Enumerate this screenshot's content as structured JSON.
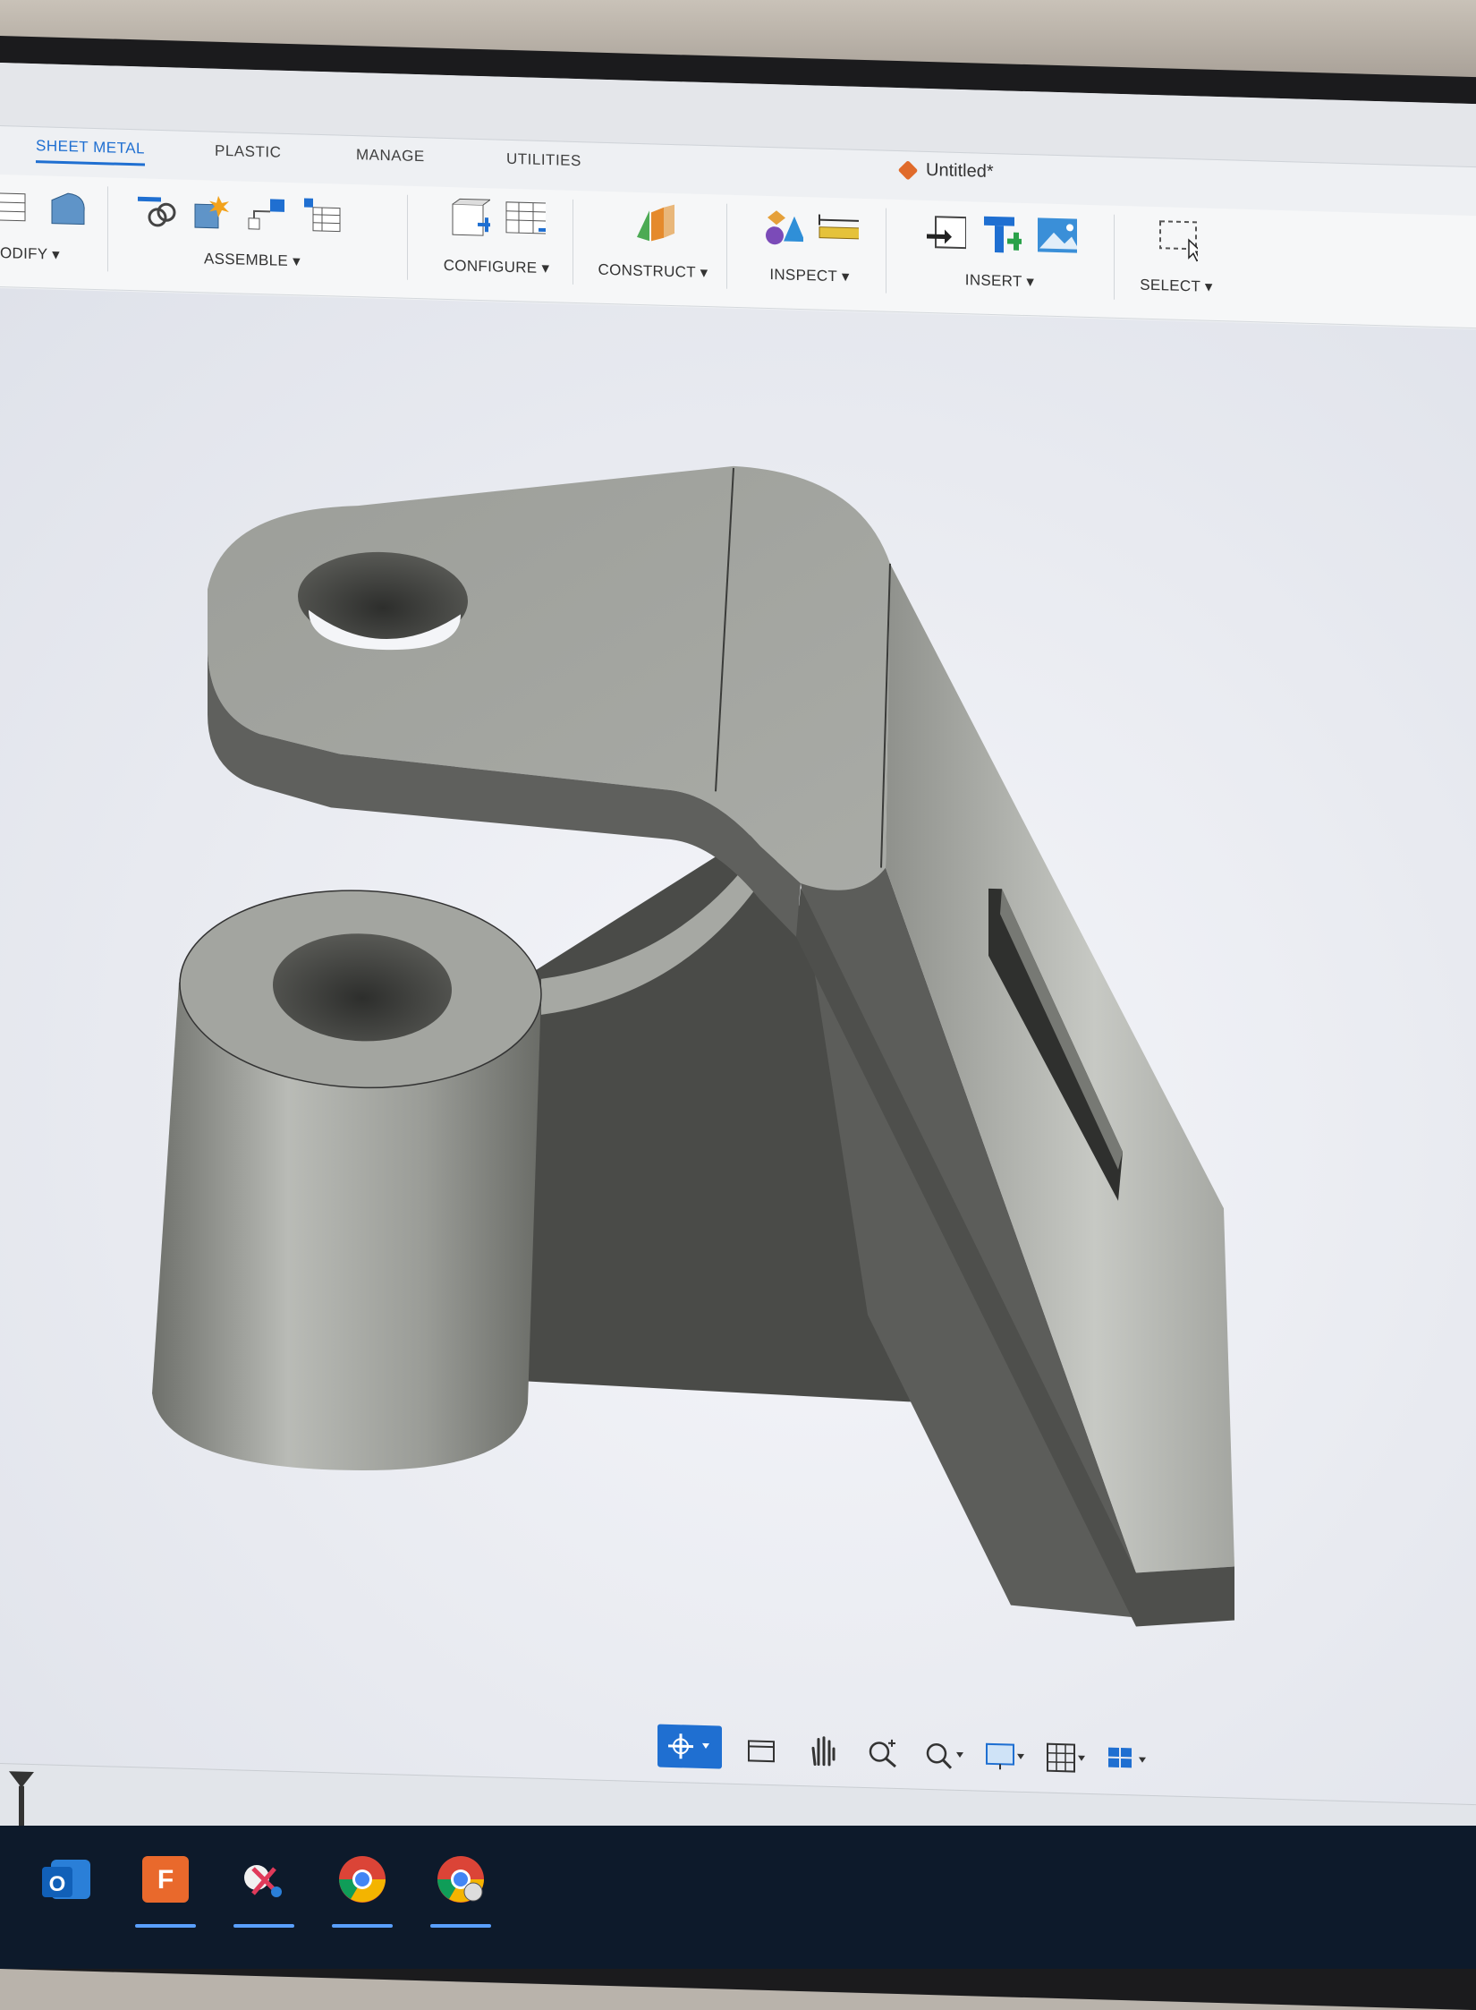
{
  "document": {
    "title": "Untitled*"
  },
  "tabs": [
    {
      "label": "SHEET METAL",
      "active": true
    },
    {
      "label": "PLASTIC"
    },
    {
      "label": "MANAGE"
    },
    {
      "label": "UTILITIES"
    }
  ],
  "ribbon": {
    "modify": "ODIFY ▾",
    "assemble": "ASSEMBLE ▾",
    "configure": "CONFIGURE ▾",
    "construct": "CONSTRUCT ▾",
    "inspect": "INSPECT ▾",
    "insert": "INSERT ▾",
    "select": "SELECT ▾"
  },
  "navigation_toolbar": [
    "orbit-icon",
    "look-at-icon",
    "pan-icon",
    "zoom-window-icon",
    "zoom-icon",
    "display-settings-icon",
    "grid-icon",
    "viewports-icon"
  ],
  "taskbar": [
    "outlook-icon",
    "fusion-360-icon",
    "snipping-tool-icon",
    "chrome-icon",
    "chrome-profile-icon"
  ],
  "colors": {
    "accent": "#1f6fd1",
    "model": "#8f918c",
    "taskbar": "#0d1a2b"
  }
}
